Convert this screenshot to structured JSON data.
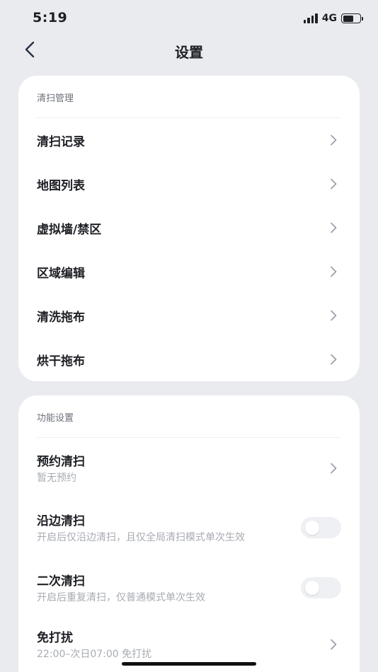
{
  "status_bar": {
    "time": "5:19",
    "network": "4G",
    "battery_level": 0.62
  },
  "nav": {
    "title": "设置",
    "back_icon": "chevron-left-icon"
  },
  "cleaning_management": {
    "title": "清扫管理",
    "items": [
      {
        "label": "清扫记录"
      },
      {
        "label": "地图列表"
      },
      {
        "label": "虚拟墙/禁区"
      },
      {
        "label": "区域编辑"
      },
      {
        "label": "清洗拖布"
      },
      {
        "label": "烘干拖布"
      }
    ]
  },
  "function_settings": {
    "title": "功能设置",
    "schedule": {
      "label": "预约清扫",
      "sub": "暂无预约"
    },
    "edge_cleaning": {
      "label": "沿边清扫",
      "sub": "开启后仅沿边清扫，且仅全局清扫模式单次生效",
      "enabled": false
    },
    "second_cleaning": {
      "label": "二次清扫",
      "sub": "开启后重复清扫，仅普通模式单次生效",
      "enabled": false
    },
    "do_not_disturb": {
      "label": "免打扰",
      "sub": "22:00–次日07:00 免打扰"
    }
  },
  "colors": {
    "background": "#e9ebef",
    "card": "#ffffff",
    "text": "#1d1f24",
    "subtext": "#a7abb2",
    "toggle_off": "#eef0f3"
  }
}
